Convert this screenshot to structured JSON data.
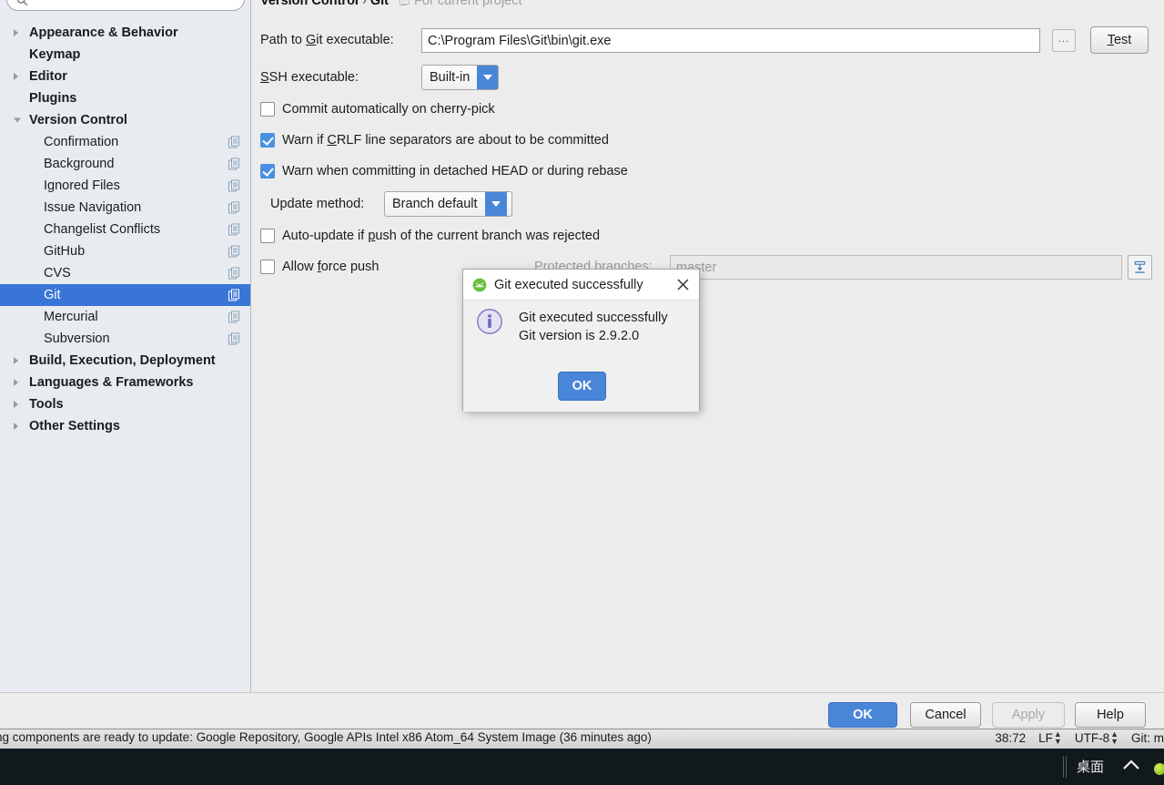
{
  "search": {
    "placeholder": ""
  },
  "sidebar": {
    "items": [
      {
        "label": "Appearance & Behavior",
        "level": 0,
        "arrow": "collapsed",
        "copy": false,
        "selected": false
      },
      {
        "label": "Keymap",
        "level": 0,
        "arrow": "none",
        "copy": false,
        "selected": false
      },
      {
        "label": "Editor",
        "level": 0,
        "arrow": "collapsed",
        "copy": false,
        "selected": false
      },
      {
        "label": "Plugins",
        "level": 0,
        "arrow": "none",
        "copy": false,
        "selected": false
      },
      {
        "label": "Version Control",
        "level": 0,
        "arrow": "expanded",
        "copy": false,
        "selected": false
      },
      {
        "label": "Confirmation",
        "level": 1,
        "arrow": "none",
        "copy": true,
        "selected": false
      },
      {
        "label": "Background",
        "level": 1,
        "arrow": "none",
        "copy": true,
        "selected": false
      },
      {
        "label": "Ignored Files",
        "level": 1,
        "arrow": "none",
        "copy": true,
        "selected": false
      },
      {
        "label": "Issue Navigation",
        "level": 1,
        "arrow": "none",
        "copy": true,
        "selected": false
      },
      {
        "label": "Changelist Conflicts",
        "level": 1,
        "arrow": "none",
        "copy": true,
        "selected": false
      },
      {
        "label": "GitHub",
        "level": 1,
        "arrow": "none",
        "copy": true,
        "selected": false
      },
      {
        "label": "CVS",
        "level": 1,
        "arrow": "none",
        "copy": true,
        "selected": false
      },
      {
        "label": "Git",
        "level": 1,
        "arrow": "none",
        "copy": true,
        "selected": true
      },
      {
        "label": "Mercurial",
        "level": 1,
        "arrow": "none",
        "copy": true,
        "selected": false
      },
      {
        "label": "Subversion",
        "level": 1,
        "arrow": "none",
        "copy": true,
        "selected": false
      },
      {
        "label": "Build, Execution, Deployment",
        "level": 0,
        "arrow": "collapsed",
        "copy": false,
        "selected": false
      },
      {
        "label": "Languages & Frameworks",
        "level": 0,
        "arrow": "collapsed",
        "copy": false,
        "selected": false
      },
      {
        "label": "Tools",
        "level": 0,
        "arrow": "collapsed",
        "copy": false,
        "selected": false
      },
      {
        "label": "Other Settings",
        "level": 0,
        "arrow": "collapsed",
        "copy": false,
        "selected": false
      }
    ]
  },
  "breadcrumb": {
    "parent": "Version Control",
    "separator": "›",
    "current": "Git",
    "note": "For current project"
  },
  "form": {
    "path_label_pre": "Path to ",
    "path_label_mnem": "G",
    "path_label_post": "it executable:",
    "path_value": "C:\\Program Files\\Git\\bin\\git.exe",
    "browse_label": "...",
    "test_label_mnem": "T",
    "test_label_post": "est",
    "ssh_label_mnem": "S",
    "ssh_label_post": "SH executable:",
    "ssh_value": "Built-in",
    "cb_cherry_pick": "Commit automatically on cherry-pick",
    "cb_crlf_pre": "Warn if ",
    "cb_crlf_mnem": "C",
    "cb_crlf_post": "RLF line separators are about to be committed",
    "cb_detached": "Warn when committing in detached HEAD or during rebase",
    "update_label": "Update method:",
    "update_value": "Branch default",
    "cb_autoupdate_pre": "Auto-update if ",
    "cb_autoupdate_mnem": "p",
    "cb_autoupdate_post": "ush of the current branch was rejected",
    "cb_force_pre": "Allow ",
    "cb_force_mnem": "f",
    "cb_force_post": "orce push",
    "protected_label": "Protected branches:",
    "protected_placeholder": "master"
  },
  "footer": {
    "ok": "OK",
    "cancel": "Cancel",
    "apply": "Apply",
    "help": "Help"
  },
  "dialog": {
    "title": "Git executed successfully",
    "line1": "Git executed successfully",
    "line2": "Git version is 2.9.2.0",
    "ok": "OK"
  },
  "statusbar": {
    "message": "ing components are ready to update: Google Repository, Google APIs Intel x86 Atom_64 System Image (36 minutes ago)",
    "position": "38:72",
    "line_sep": "LF",
    "encoding": "UTF-8",
    "vcs": "Git: m"
  },
  "taskbar": {
    "desktop_label": "桌面"
  },
  "colors": {
    "accent": "#4a86d8",
    "selection": "#3875d7",
    "sidebar_bg": "#e8ecf0",
    "panel_bg": "#ececec"
  }
}
